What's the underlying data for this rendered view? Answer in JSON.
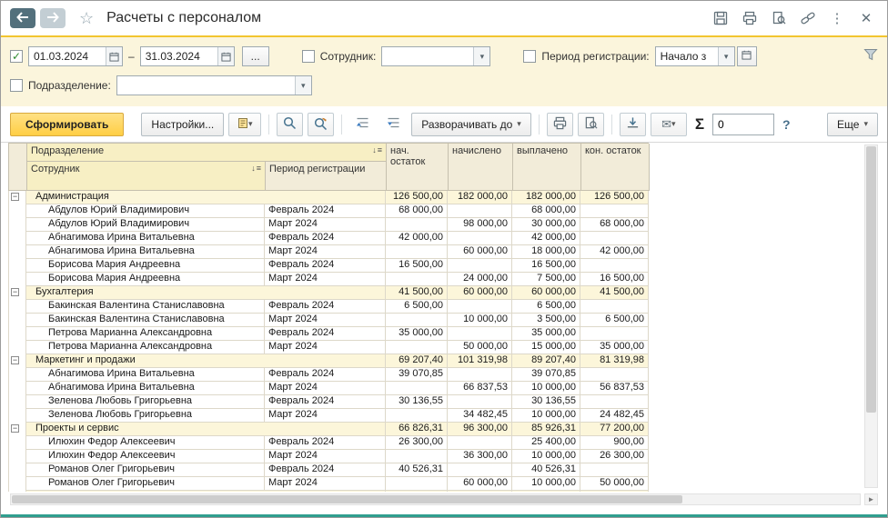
{
  "window": {
    "title": "Расчеты с персоналом"
  },
  "icons": {
    "kebab": "⋮",
    "close": "✕",
    "star": "☆",
    "dropdown": "▾",
    "collapse": "−",
    "sort_arrow": "↓",
    "sort_bars": "≡",
    "scroll_right": "►",
    "envelope": "✉"
  },
  "filters": {
    "period_enabled": "✓",
    "date_from": "01.03.2024",
    "date_to": "31.03.2024",
    "range_separator": "–",
    "ellipsis_button": "...",
    "employee": {
      "label": "Сотрудник:",
      "value": ""
    },
    "registration_period": {
      "label": "Период регистрации:",
      "value": "Начало з"
    },
    "department": {
      "label": "Подразделение:",
      "value": ""
    }
  },
  "toolbar": {
    "generate_label": "Сформировать",
    "settings_label": "Настройки...",
    "expand_to_label": "Разворачивать до",
    "sum_symbol": "Σ",
    "counter_value": "0",
    "help_label": "?",
    "more_label": "Еще"
  },
  "table": {
    "columns": {
      "department": "Подразделение",
      "employee": "Сотрудник",
      "period": "Период регистрации",
      "beginning_balance": "нач. остаток",
      "accrued": "начислено",
      "paid": "выплачено",
      "ending_balance": "кон. остаток"
    },
    "rows": [
      {
        "type": "group",
        "name": "Администрация",
        "period": "",
        "beg": "126 500,00",
        "accrued": "182 000,00",
        "paid": "182 000,00",
        "end": "126 500,00"
      },
      {
        "type": "detail",
        "name": "Абдулов Юрий Владимирович",
        "period": "Февраль 2024",
        "beg": "68 000,00",
        "accrued": "",
        "paid": "68 000,00",
        "end": ""
      },
      {
        "type": "detail",
        "name": "Абдулов Юрий Владимирович",
        "period": "Март 2024",
        "beg": "",
        "accrued": "98 000,00",
        "paid": "30 000,00",
        "end": "68 000,00"
      },
      {
        "type": "detail",
        "name": "Абнагимова Ирина Витальевна",
        "period": "Февраль 2024",
        "beg": "42 000,00",
        "accrued": "",
        "paid": "42 000,00",
        "end": ""
      },
      {
        "type": "detail",
        "name": "Абнагимова Ирина Витальевна",
        "period": "Март 2024",
        "beg": "",
        "accrued": "60 000,00",
        "paid": "18 000,00",
        "end": "42 000,00"
      },
      {
        "type": "detail",
        "name": "Борисова Мария Андреевна",
        "period": "Февраль 2024",
        "beg": "16 500,00",
        "accrued": "",
        "paid": "16 500,00",
        "end": ""
      },
      {
        "type": "detail",
        "name": "Борисова Мария Андреевна",
        "period": "Март 2024",
        "beg": "",
        "accrued": "24 000,00",
        "paid": "7 500,00",
        "end": "16 500,00"
      },
      {
        "type": "group",
        "name": "Бухгалтерия",
        "period": "",
        "beg": "41 500,00",
        "accrued": "60 000,00",
        "paid": "60 000,00",
        "end": "41 500,00"
      },
      {
        "type": "detail",
        "name": "Бакинская Валентина Станиславовна",
        "period": "Февраль 2024",
        "beg": "6 500,00",
        "accrued": "",
        "paid": "6 500,00",
        "end": ""
      },
      {
        "type": "detail",
        "name": "Бакинская Валентина Станиславовна",
        "period": "Март 2024",
        "beg": "",
        "accrued": "10 000,00",
        "paid": "3 500,00",
        "end": "6 500,00"
      },
      {
        "type": "detail",
        "name": "Петрова Марианна Александровна",
        "period": "Февраль 2024",
        "beg": "35 000,00",
        "accrued": "",
        "paid": "35 000,00",
        "end": ""
      },
      {
        "type": "detail",
        "name": "Петрова Марианна Александровна",
        "period": "Март 2024",
        "beg": "",
        "accrued": "50 000,00",
        "paid": "15 000,00",
        "end": "35 000,00"
      },
      {
        "type": "group",
        "name": "Маркетинг и продажи",
        "period": "",
        "beg": "69 207,40",
        "accrued": "101 319,98",
        "paid": "89 207,40",
        "end": "81 319,98"
      },
      {
        "type": "detail",
        "name": "Абнагимова Ирина Витальевна",
        "period": "Февраль 2024",
        "beg": "39 070,85",
        "accrued": "",
        "paid": "39 070,85",
        "end": ""
      },
      {
        "type": "detail",
        "name": "Абнагимова Ирина Витальевна",
        "period": "Март 2024",
        "beg": "",
        "accrued": "66 837,53",
        "paid": "10 000,00",
        "end": "56 837,53"
      },
      {
        "type": "detail",
        "name": "Зеленова Любовь Григорьевна",
        "period": "Февраль 2024",
        "beg": "30 136,55",
        "accrued": "",
        "paid": "30 136,55",
        "end": ""
      },
      {
        "type": "detail",
        "name": "Зеленова Любовь Григорьевна",
        "period": "Март 2024",
        "beg": "",
        "accrued": "34 482,45",
        "paid": "10 000,00",
        "end": "24 482,45"
      },
      {
        "type": "group",
        "name": "Проекты и сервис",
        "period": "",
        "beg": "66 826,31",
        "accrued": "96 300,00",
        "paid": "85 926,31",
        "end": "77 200,00"
      },
      {
        "type": "detail",
        "name": "Илюхин Федор Алексеевич",
        "period": "Февраль 2024",
        "beg": "26 300,00",
        "accrued": "",
        "paid": "25 400,00",
        "end": "900,00"
      },
      {
        "type": "detail",
        "name": "Илюхин Федор Алексеевич",
        "period": "Март 2024",
        "beg": "",
        "accrued": "36 300,00",
        "paid": "10 000,00",
        "end": "26 300,00"
      },
      {
        "type": "detail",
        "name": "Романов Олег Григорьевич",
        "period": "Февраль 2024",
        "beg": "40 526,31",
        "accrued": "",
        "paid": "40 526,31",
        "end": ""
      },
      {
        "type": "detail",
        "name": "Романов Олег Григорьевич",
        "period": "Март 2024",
        "beg": "",
        "accrued": "60 000,00",
        "paid": "10 000,00",
        "end": "50 000,00"
      },
      {
        "type": "partial",
        "name": "",
        "period": "",
        "beg": "",
        "accrued": "",
        "paid": "",
        "end": ""
      }
    ]
  }
}
